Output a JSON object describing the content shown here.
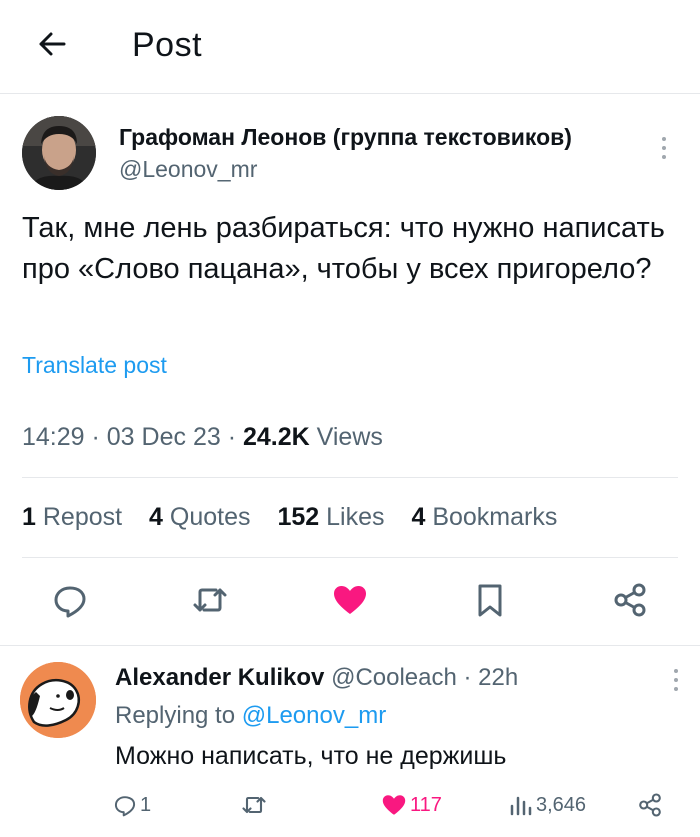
{
  "header": {
    "title": "Post"
  },
  "post": {
    "author_name": "Графоман Леонов (группа текстовиков)",
    "author_handle": "@Leonov_mr",
    "text": "Так, мне лень разбираться: что нужно написать про «Слово пацана», чтобы у всех пригорело?",
    "translate_label": "Translate post",
    "time": "14:29",
    "date": "03 Dec 23",
    "views_count": "24.2K",
    "views_label": "Views",
    "stats": {
      "reposts_count": "1",
      "reposts_label": "Repost",
      "quotes_count": "4",
      "quotes_label": "Quotes",
      "likes_count": "152",
      "likes_label": "Likes",
      "bookmarks_count": "4",
      "bookmarks_label": "Bookmarks"
    },
    "liked": true
  },
  "reply": {
    "author_name": "Alexander Kulikov",
    "author_handle": "@Cooleach",
    "time": "22h",
    "replying_prefix": "Replying to",
    "replying_to": "@Leonov_mr",
    "text": "Можно написать, что не держишь",
    "reply_count": "1",
    "like_count": "117",
    "views_count": "3,646",
    "liked": true
  },
  "icons": {
    "back": "arrow-left-icon",
    "more": "more-vertical-icon",
    "reply": "comment-icon",
    "repost": "repost-icon",
    "like": "heart-icon",
    "bookmark": "bookmark-icon",
    "share": "share-icon",
    "views": "analytics-icon"
  },
  "colors": {
    "accent": "#1d9bf0",
    "like": "#f91880",
    "muted": "#536471",
    "text": "#0f1419"
  }
}
